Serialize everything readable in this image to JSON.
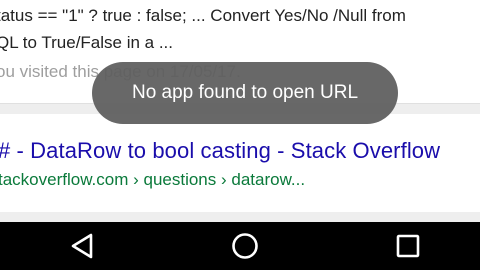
{
  "results": {
    "first": {
      "snippet_line1": "tatus == \"1\" ? true : false; ... Convert Yes/No /Null from",
      "snippet_line2": "QL to True/False in a ...",
      "visited": "ou visited this page on 17/05/17."
    },
    "second": {
      "title": "# - DataRow to bool casting - Stack Overflow",
      "url": "tackoverflow.com › questions › datarow..."
    }
  },
  "toast": {
    "message": "No app found to open URL"
  },
  "navbar": {
    "icons": [
      "back-icon",
      "home-icon",
      "recent-apps-icon"
    ]
  },
  "colors": {
    "title_link": "#1a0dab",
    "url_green": "#0b7a3b",
    "toast_bg": "#5f5f5f",
    "navbar_bg": "#000000"
  }
}
